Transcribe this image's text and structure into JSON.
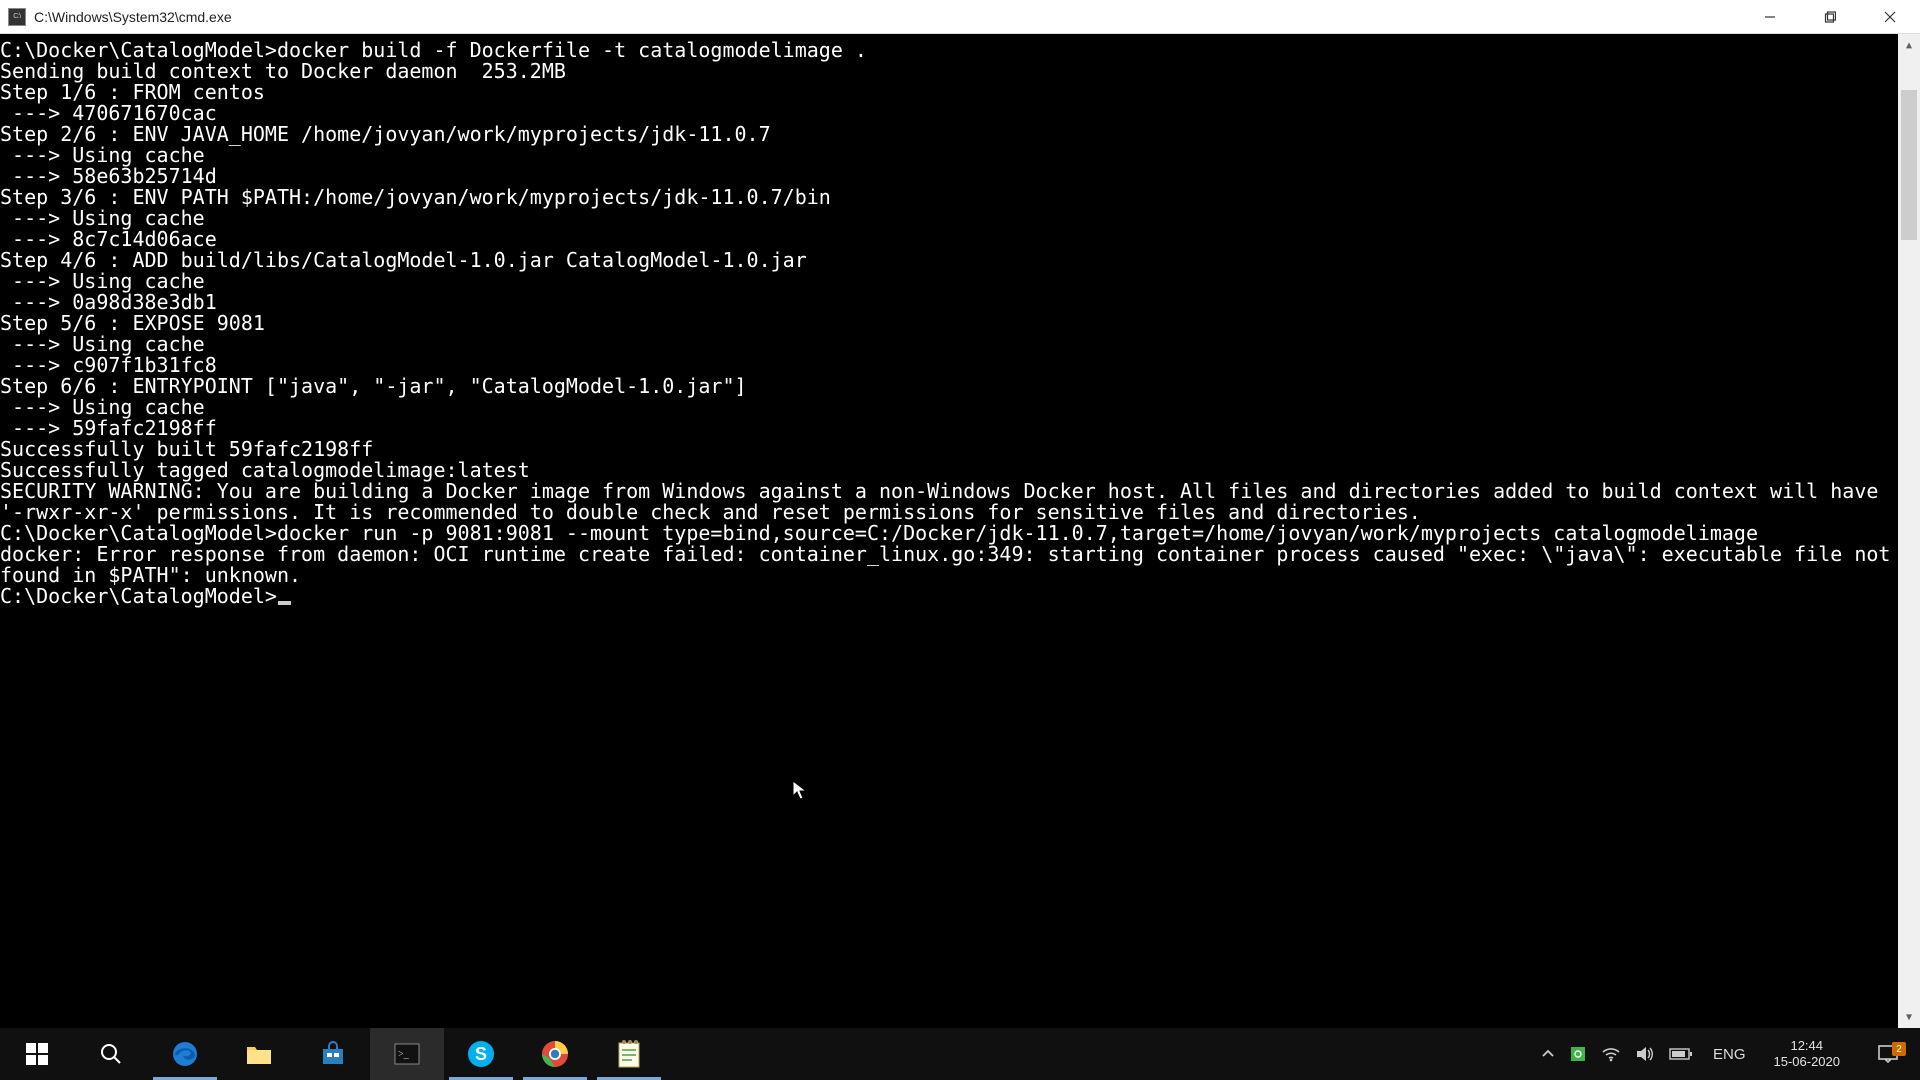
{
  "window": {
    "title": "C:\\Windows\\System32\\cmd.exe",
    "app_icon_label": "C:\\"
  },
  "terminal": {
    "lines": [
      "C:\\Docker\\CatalogModel>docker build -f Dockerfile -t catalogmodelimage .",
      "Sending build context to Docker daemon  253.2MB",
      "Step 1/6 : FROM centos",
      " ---> 470671670cac",
      "Step 2/6 : ENV JAVA_HOME /home/jovyan/work/myprojects/jdk-11.0.7",
      " ---> Using cache",
      " ---> 58e63b25714d",
      "Step 3/6 : ENV PATH $PATH:/home/jovyan/work/myprojects/jdk-11.0.7/bin",
      " ---> Using cache",
      " ---> 8c7c14d06ace",
      "Step 4/6 : ADD build/libs/CatalogModel-1.0.jar CatalogModel-1.0.jar",
      " ---> Using cache",
      " ---> 0a98d38e3db1",
      "Step 5/6 : EXPOSE 9081",
      " ---> Using cache",
      " ---> c907f1b31fc8",
      "Step 6/6 : ENTRYPOINT [\"java\", \"-jar\", \"CatalogModel-1.0.jar\"]",
      " ---> Using cache",
      " ---> 59fafc2198ff",
      "Successfully built 59fafc2198ff",
      "Successfully tagged catalogmodelimage:latest",
      "SECURITY WARNING: You are building a Docker image from Windows against a non-Windows Docker host. All files and directories added to build context will have '-rwxr-xr-x' permissions. It is recommended to double check and reset permissions for sensitive files and directories.",
      "",
      "C:\\Docker\\CatalogModel>docker run -p 9081:9081 --mount type=bind,source=C:/Docker/jdk-11.0.7,target=/home/jovyan/work/myprojects catalogmodelimage",
      "docker: Error response from daemon: OCI runtime create failed: container_linux.go:349: starting container process caused \"exec: \\\"java\\\": executable file not found in $PATH\": unknown.",
      ""
    ],
    "prompt": "C:\\Docker\\CatalogModel>"
  },
  "taskbar": {
    "language": "ENG",
    "time": "12:44",
    "date": "15-06-2020",
    "notification_count": "2"
  }
}
